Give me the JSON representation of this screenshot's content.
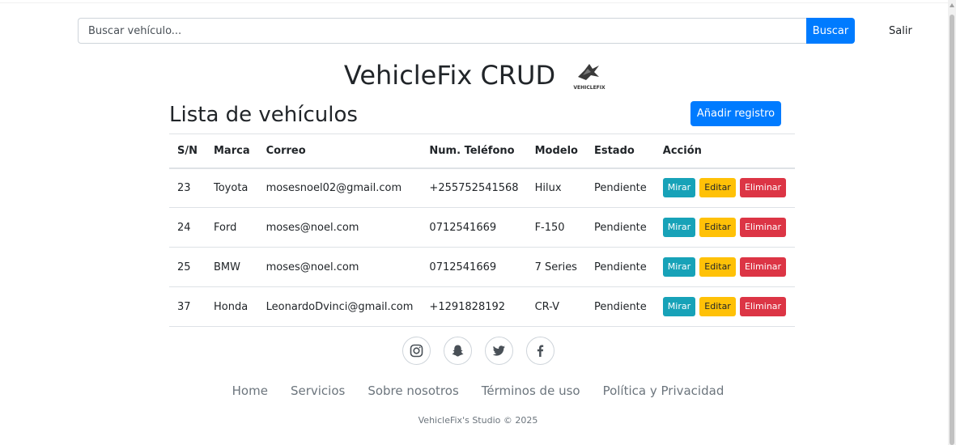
{
  "search": {
    "placeholder": "Buscar vehículo...",
    "button_label": "Buscar"
  },
  "nav": {
    "logout_label": "Salir"
  },
  "header": {
    "title": "VehicleFix CRUD",
    "logo_text": "VEHICLEFIX"
  },
  "list": {
    "title": "Lista de vehículos",
    "add_button": "Añadir registro",
    "columns": [
      "S/N",
      "Marca",
      "Correo",
      "Num. Teléfono",
      "Modelo",
      "Estado",
      "Acción"
    ],
    "rows": [
      {
        "sn": "23",
        "marca": "Toyota",
        "correo": "mosesnoel02@gmail.com",
        "telefono": "+255752541568",
        "modelo": "Hilux",
        "estado": "Pendiente"
      },
      {
        "sn": "24",
        "marca": "Ford",
        "correo": "moses@noel.com",
        "telefono": "0712541669",
        "modelo": "F-150",
        "estado": "Pendiente"
      },
      {
        "sn": "25",
        "marca": "BMW",
        "correo": "moses@noel.com",
        "telefono": "0712541669",
        "modelo": "7 Series",
        "estado": "Pendiente"
      },
      {
        "sn": "37",
        "marca": "Honda",
        "correo": "LeonardoDvinci@gmail.com",
        "telefono": "+1291828192",
        "modelo": "CR-V",
        "estado": "Pendiente"
      }
    ],
    "actions": {
      "view": "Mirar",
      "edit": "Editar",
      "delete": "Eliminar"
    }
  },
  "social": [
    "instagram-icon",
    "snapchat-icon",
    "twitter-icon",
    "facebook-icon"
  ],
  "footer": {
    "links": [
      "Home",
      "Servicios",
      "Sobre nosotros",
      "Términos de uso",
      "Política y Privacidad"
    ],
    "copyright": "VehicleFix's Studio © 2025"
  },
  "colors": {
    "primary": "#007bff",
    "info": "#17a2b8",
    "warning": "#ffc107",
    "danger": "#dc3545"
  }
}
